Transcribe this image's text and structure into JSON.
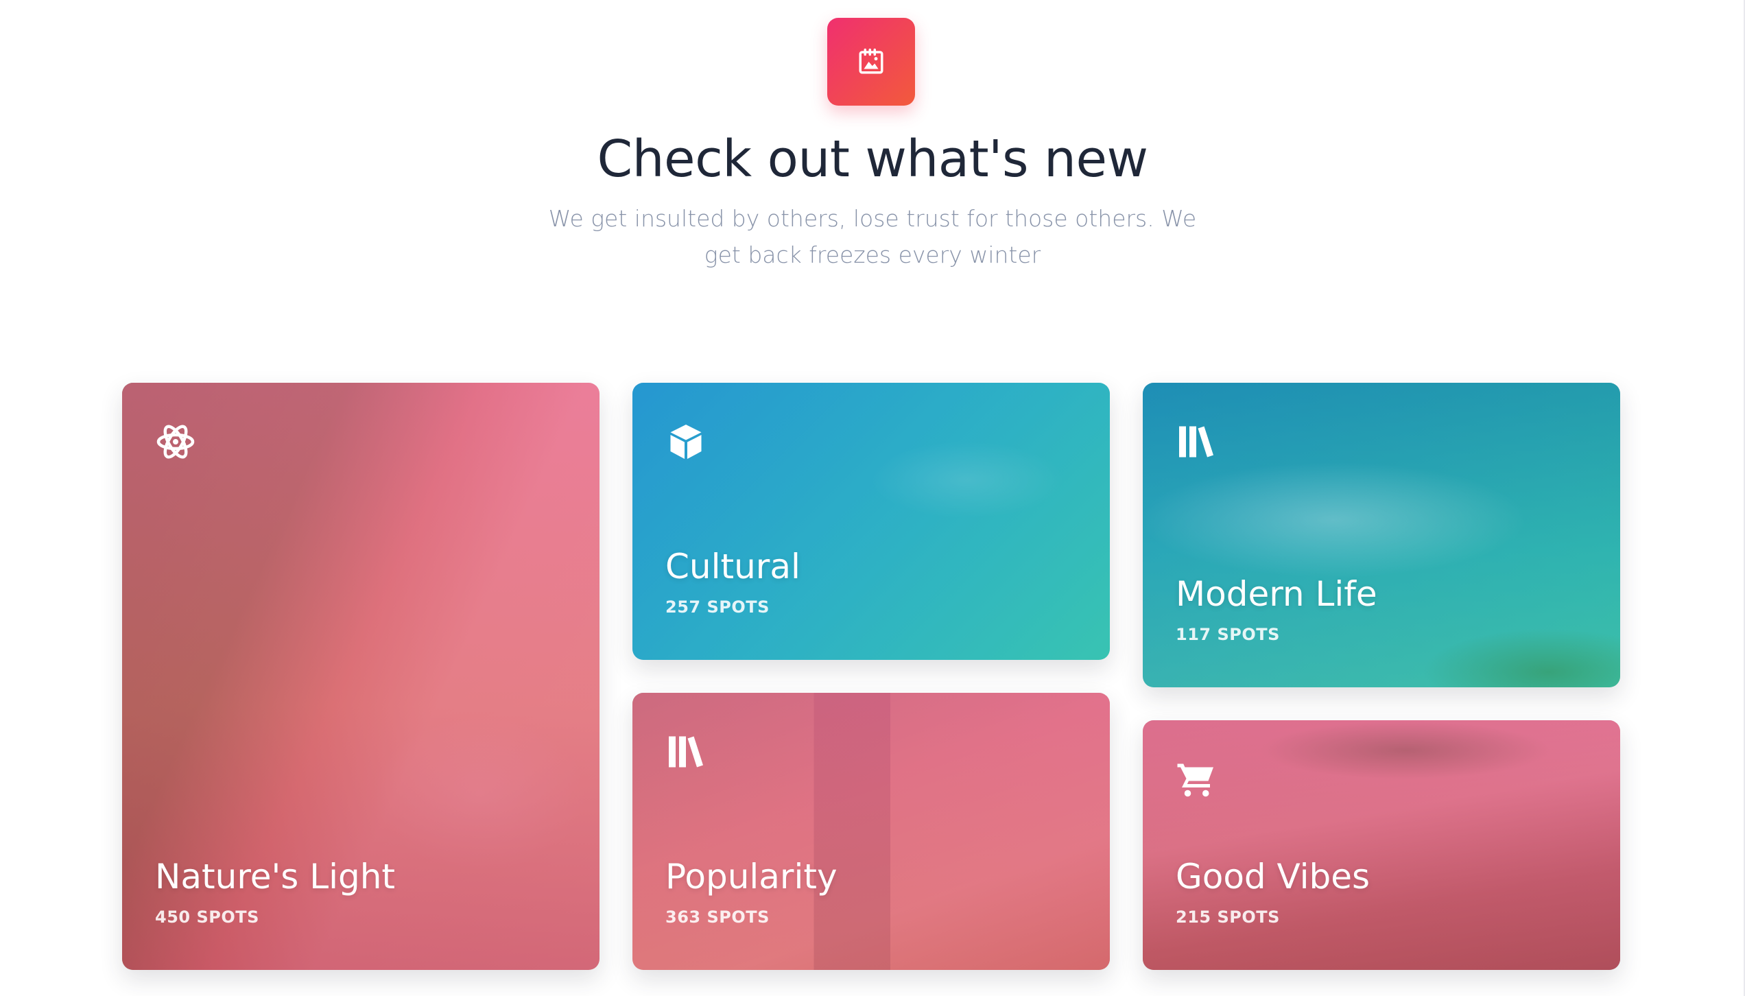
{
  "header": {
    "badge_icon": "image-calendar-icon",
    "title": "Check out what's new",
    "subtitle": "We get insulted by others, lose trust for those others. We get back freezes every winter"
  },
  "cards": [
    {
      "icon": "atom-icon",
      "title": "Nature's Light",
      "spots": "450 SPOTS"
    },
    {
      "icon": "cube-icon",
      "title": "Cultural",
      "spots": "257 SPOTS"
    },
    {
      "icon": "library-books-icon",
      "title": "Modern Life",
      "spots": "117 SPOTS"
    },
    {
      "icon": "library-books-icon",
      "title": "Popularity",
      "spots": "363 SPOTS"
    },
    {
      "icon": "shopping-cart-icon",
      "title": "Good Vibes",
      "spots": "215 SPOTS"
    }
  ],
  "colors": {
    "badge_gradient_start": "#f0306f",
    "badge_gradient_end": "#f25a3c",
    "title": "#1f2738",
    "subtitle": "#8792a8",
    "pink_overlay": "#ec5e8c",
    "teal_overlay": "#28bebe"
  }
}
